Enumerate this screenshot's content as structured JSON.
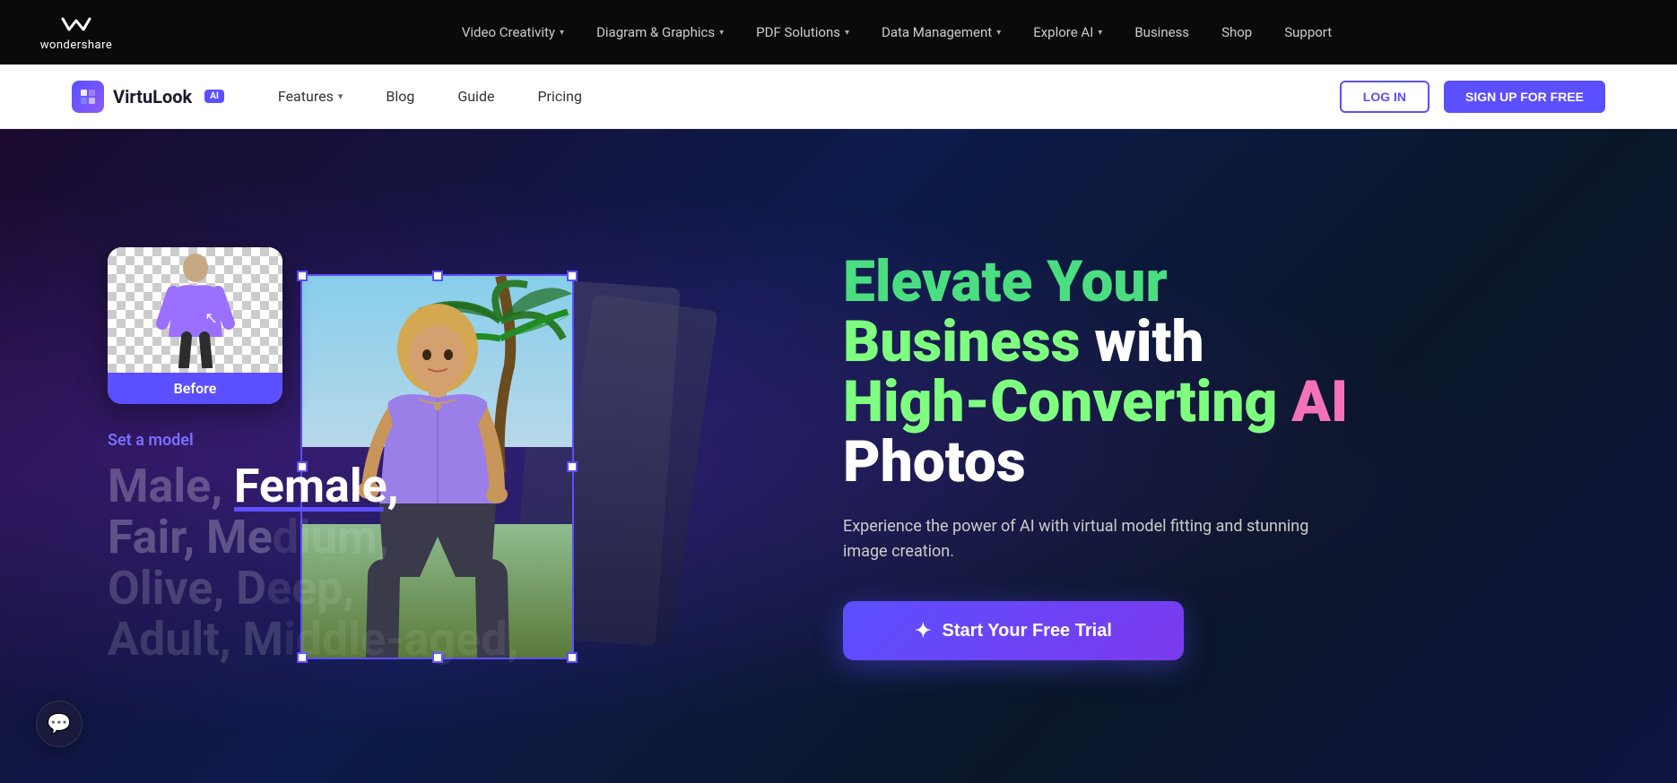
{
  "topNav": {
    "logo": {
      "text": "wondershare"
    },
    "links": [
      {
        "label": "Video Creativity",
        "hasDropdown": true
      },
      {
        "label": "Diagram & Graphics",
        "hasDropdown": true
      },
      {
        "label": "PDF Solutions",
        "hasDropdown": true
      },
      {
        "label": "Data Management",
        "hasDropdown": true
      },
      {
        "label": "Explore AI",
        "hasDropdown": true
      },
      {
        "label": "Business",
        "hasDropdown": false
      },
      {
        "label": "Shop",
        "hasDropdown": false
      },
      {
        "label": "Support",
        "hasDropdown": false
      }
    ]
  },
  "productNav": {
    "productName": "VirtuLook",
    "aiBadge": "AI",
    "links": [
      {
        "label": "Features",
        "hasDropdown": true
      },
      {
        "label": "Blog",
        "hasDropdown": false
      },
      {
        "label": "Guide",
        "hasDropdown": false
      },
      {
        "label": "Pricing",
        "hasDropdown": false
      }
    ],
    "loginLabel": "LOG IN",
    "signupLabel": "SIGN UP FOR FREE"
  },
  "hero": {
    "setModelLabel": "Set a model",
    "modelOptions": "Male, Female, Fair, Medium, Olive, Deep, Adult, Middle-aged,",
    "highlightedOption": "Female,",
    "beforeLabel": "Before",
    "headline": {
      "line1": "Elevate Your",
      "line2": "Business with",
      "line3": "High-Converting AI",
      "line4": "Photos"
    },
    "subtitle": "Experience the power of AI with virtual model fitting and stunning image creation.",
    "ctaLabel": "Start Your Free Trial",
    "ctaIcon": "✦"
  },
  "chat": {
    "icon": "💬"
  }
}
